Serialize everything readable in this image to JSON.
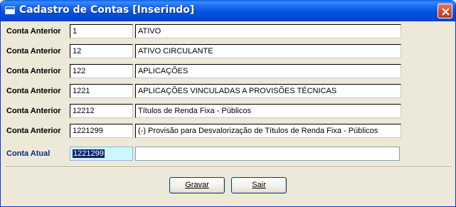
{
  "window": {
    "title": "Cadastro de Contas [Inserindo]"
  },
  "rows": [
    {
      "label": "Conta Anterior",
      "code": "1",
      "description": "ATIVO"
    },
    {
      "label": "Conta Anterior",
      "code": "12",
      "description": "ATIVO CIRCULANTE"
    },
    {
      "label": "Conta Anterior",
      "code": "122",
      "description": "APLICAÇÕES"
    },
    {
      "label": "Conta Anterior",
      "code": "1221",
      "description": "APLICAÇÕES VINCULADAS A PROVISÕES TÉCNICAS"
    },
    {
      "label": "Conta Anterior",
      "code": "12212",
      "description": "Títulos de Renda Fixa - Públicos"
    },
    {
      "label": "Conta Anterior",
      "code": "1221299",
      "description": "(-) Provisão para Desvalorização de Títulos de Renda Fixa - Públicos"
    }
  ],
  "current": {
    "label": "Conta Atual",
    "code": "1221299",
    "description": ""
  },
  "buttons": {
    "save_label": "Gravar",
    "exit_label": "Sair"
  }
}
